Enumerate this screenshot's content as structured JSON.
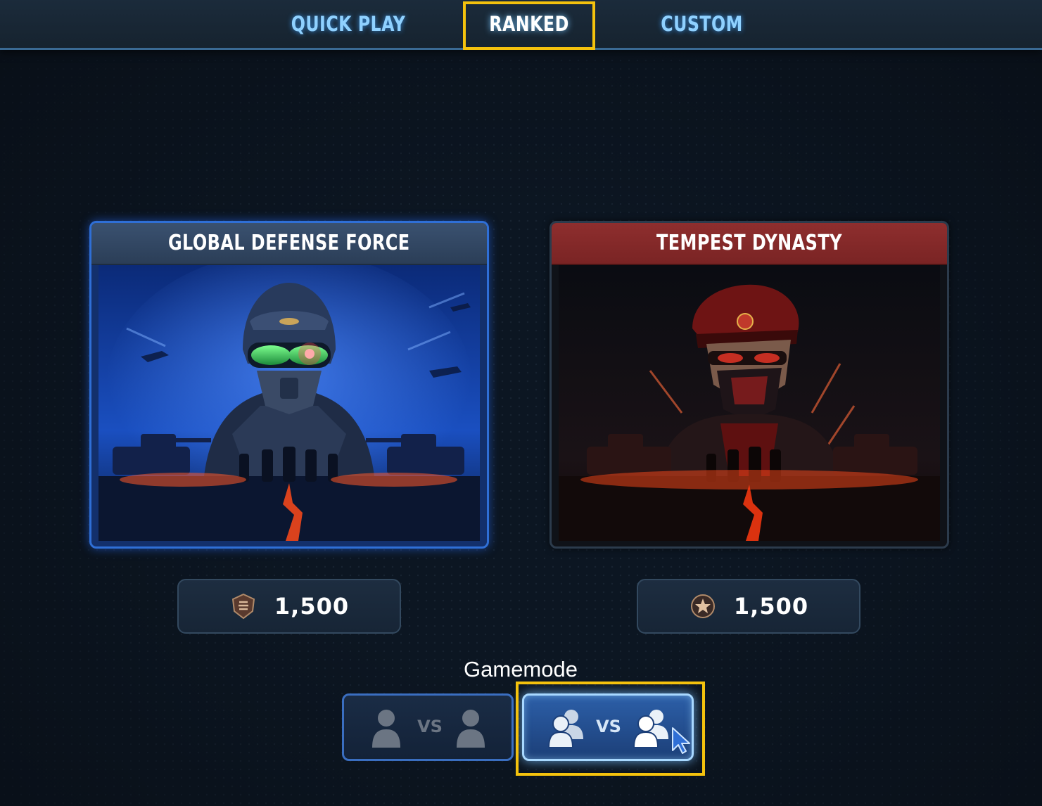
{
  "tabs": [
    {
      "label": "QUICK PLAY",
      "active": false
    },
    {
      "label": "RANKED",
      "active": true
    },
    {
      "label": "CUSTOM",
      "active": false
    }
  ],
  "factions": [
    {
      "name": "GLOBAL DEFENSE FORCE",
      "rating": "1,500",
      "rank_icon": "shield-rank-icon",
      "theme_color": "#2f6fd6"
    },
    {
      "name": "TEMPEST DYNASTY",
      "rating": "1,500",
      "rank_icon": "star-rank-icon",
      "theme_color": "#8e2e2e"
    }
  ],
  "gamemode": {
    "label": "Gamemode",
    "options": [
      {
        "vs_label": "VS",
        "selected": false
      },
      {
        "vs_label": "VS",
        "selected": true
      }
    ]
  },
  "colors": {
    "highlight": "#f4c20d",
    "accent": "#8fd1ff"
  }
}
